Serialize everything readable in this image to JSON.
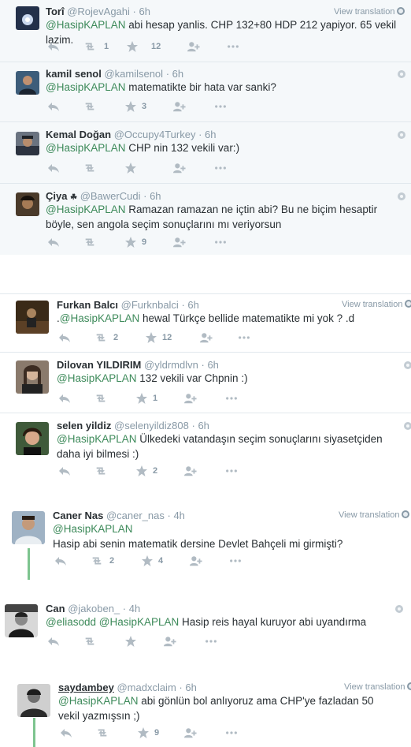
{
  "translate_label": "View translation",
  "tweets": [
    {
      "fullname": "Torî",
      "screen_name": "@RojevAgahi",
      "time": "6h",
      "mention": "@HasipKAPLAN",
      "text": " abi hesap yanlis. CHP 132+80 HDP 212 yapiyor. 65 vekil lazim.",
      "retweets": "1",
      "favorites": "12",
      "translation": true
    },
    {
      "fullname": "kamil senol",
      "screen_name": "@kamilsenol",
      "time": "6h",
      "mention": "@HasipKAPLAN",
      "text": " matematikte bir hata var sanki?",
      "retweets": "",
      "favorites": "3",
      "translation": false
    },
    {
      "fullname": "Kemal Doğan",
      "screen_name": "@Occupy4Turkey",
      "time": "6h",
      "mention": "@HasipKAPLAN",
      "text": " CHP nin 132 vekili var:)",
      "retweets": "",
      "favorites": "",
      "translation": false
    },
    {
      "fullname": "Çiya",
      "badge": "☘",
      "screen_name": "@BawerCudi",
      "time": "6h",
      "mention": "@HasipKAPLAN",
      "text": " Ramazan ramazan ne içtin abi? Bu ne biçim hesaptir böyle, sen angola seçim sonuçlarını mı veriyorsun",
      "retweets": "",
      "favorites": "9",
      "translation": false
    },
    {
      "fullname": "Furkan Balcı",
      "screen_name": "@Furknbalci",
      "time": "6h",
      "prefix": ".",
      "mention": "@HasipKAPLAN",
      "text": " hewal Türkçe bellide matematikte mi yok ? .d",
      "retweets": "2",
      "favorites": "12",
      "translation": true
    },
    {
      "fullname": "Dilovan YILDIRIM",
      "screen_name": "@yldrmdlvn",
      "time": "6h",
      "mention": "@HasipKAPLAN",
      "text": " 132 vekili var Chpnin :)",
      "retweets": "",
      "favorites": "1",
      "translation": false
    },
    {
      "fullname": "selen yildiz",
      "screen_name": "@selenyildiz808",
      "time": "6h",
      "mention": "@HasipKAPLAN",
      "text": " Ülkedeki vatandaşın seçim sonuçlarını siyasetçiden daha iyi bilmesi :)",
      "retweets": "",
      "favorites": "2",
      "translation": false
    },
    {
      "fullname": "Caner Nas",
      "screen_name": "@caner_nas",
      "time": "4h",
      "mention": "@HasipKAPLAN",
      "text": "Hasip abi senin matematik dersine Devlet Bahçeli mi girmişti?",
      "retweets": "2",
      "favorites": "4",
      "translation": true
    },
    {
      "fullname": "Can",
      "screen_name": "@jakoben_",
      "time": "4h",
      "mention": "@eliasodd",
      "mention2": "@HasipKAPLAN",
      "text": " Hasip reis hayal kuruyor abi uyandırma",
      "retweets": "",
      "favorites": "",
      "translation": false
    },
    {
      "fullname": "saydambey",
      "screen_name": "@madxclaim",
      "time": "6h",
      "mention": "@HasipKAPLAN",
      "text": " abi gönlün bol anlıyoruz ama CHP'ye fazladan 50 vekil yazmışsın ;)",
      "retweets": "",
      "favorites": "9",
      "translation": true
    }
  ]
}
